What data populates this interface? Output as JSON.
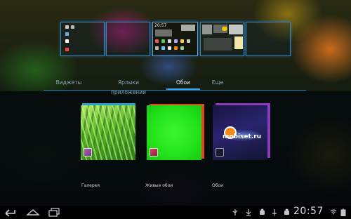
{
  "tabs": [
    {
      "label": "Виджеты",
      "active": false
    },
    {
      "label": "Ярлыки приложений",
      "active": false
    },
    {
      "label": "Обои",
      "active": true
    },
    {
      "label": "Еще",
      "active": false
    }
  ],
  "home_screens": {
    "count": 5,
    "current_index": 2,
    "thumb_clock": "20:57"
  },
  "wallpaper_sources": [
    {
      "label": "Галерея"
    },
    {
      "label": "Живые обои"
    },
    {
      "label": "Обои"
    }
  ],
  "watermark": "mobiset.ru",
  "system_bar": {
    "time": "20:57",
    "nav_icons": [
      "back-icon",
      "home-icon",
      "recent-apps-icon"
    ],
    "notification_icons": [
      "usb-icon",
      "download-icon",
      "android-icon",
      "usb-debug-icon",
      "android-icon"
    ],
    "status_icons": [
      "wifi-icon",
      "battery-icon"
    ]
  },
  "colors": {
    "accent": "#38a6ee",
    "screen_border": "#2f87c8",
    "green_wallpaper": "#22e31a"
  }
}
